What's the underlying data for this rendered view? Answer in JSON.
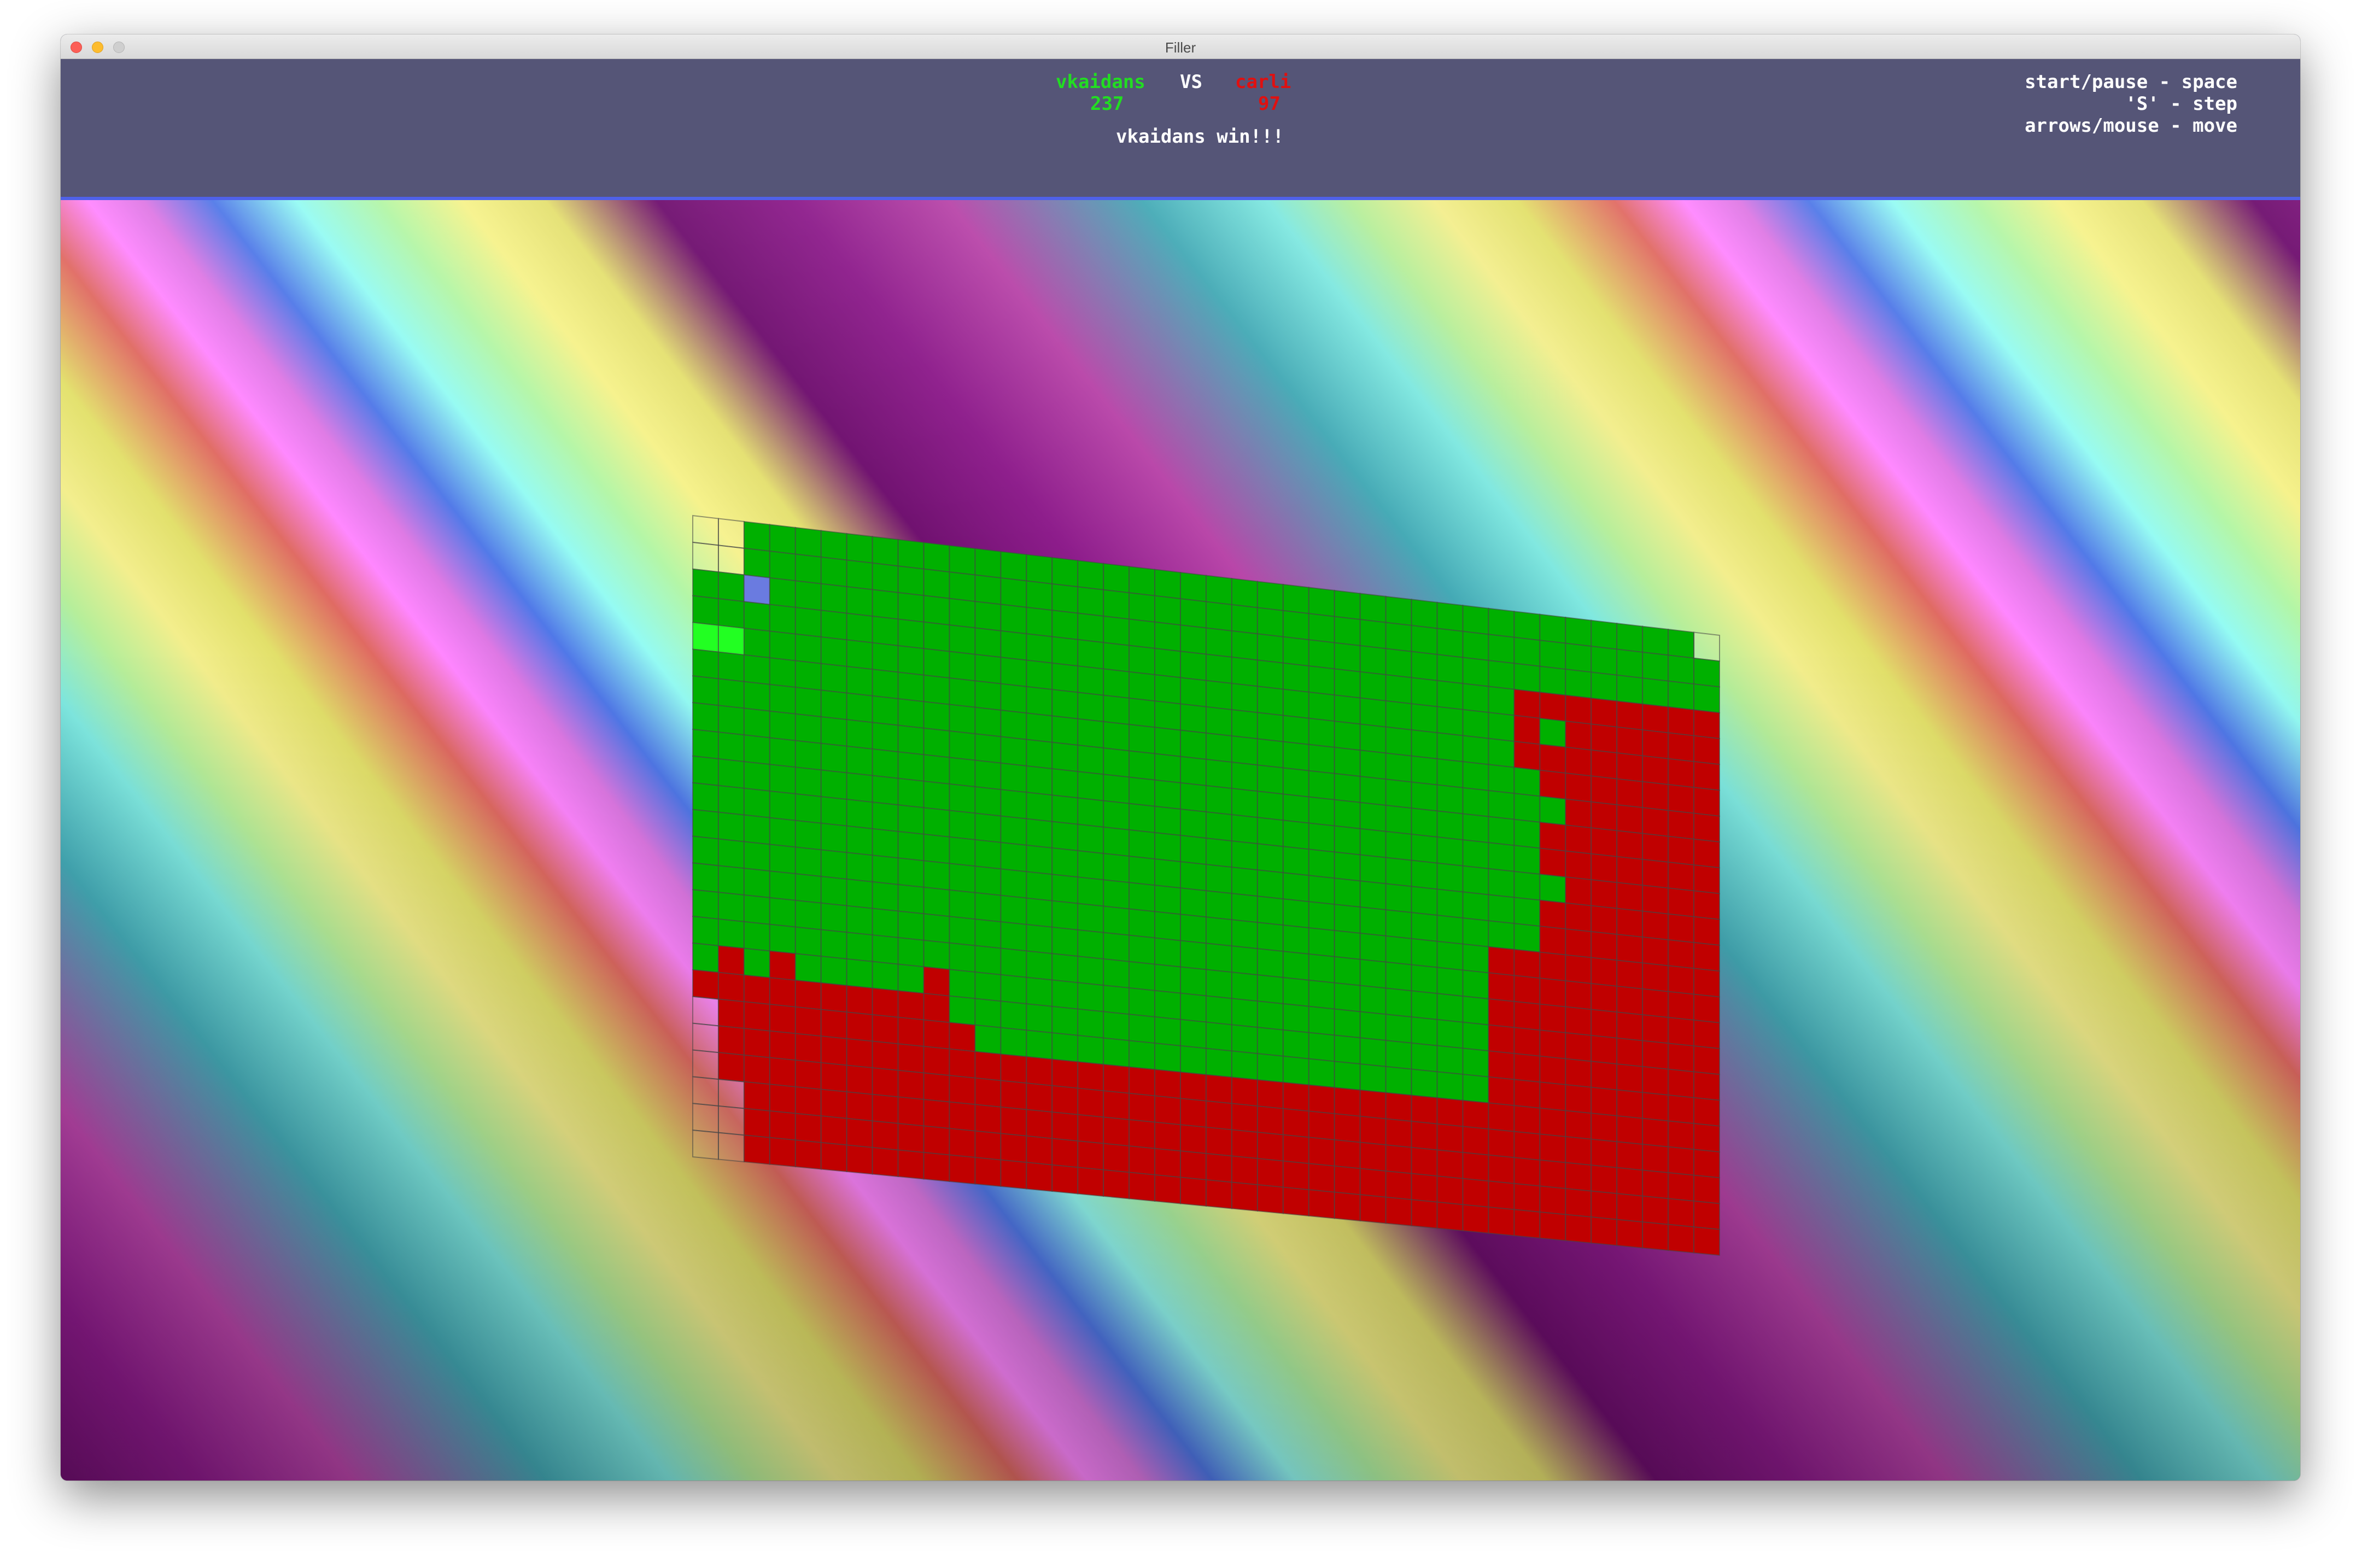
{
  "window": {
    "title": "Filler"
  },
  "players": {
    "p1": {
      "name": "vkaidans",
      "score": "237",
      "color": "#22dd22"
    },
    "vs": "VS",
    "p2": {
      "name": "carli",
      "score": "97",
      "color": "#e01010"
    }
  },
  "result": "vkaidans win!!!",
  "help": [
    "start/pause - space",
    "'S' - step",
    "arrows/mouse - move"
  ],
  "board": {
    "cols": 40,
    "rows": 24,
    "cells": [
      "EE.....................................E",
      "EE......................................",
      "..B.....................................",
      "................................RR......",
      "NN..............................R.......",
      "................................RR......",
      "........................................",
      "........................................",
      "........................................",
      "........................................",
      "........................................",
      "........................................",
      "........................................",
      "........................................",
      "........................................",
      "........................................",
      ".R.R.....R..............................",
      "RRRRRRRRRR..............................",
      "ERRRRRRRRRR.............................",
      "ERRRRRRRRRRRRRRRRRRRRRRRRRRRRRRRRRRRRRRR",
      "ERRRRRRRRRRRRRRRRRRRRRRRRRRRRRRRRRRRRRRR",
      "EERRRRRRRRRRRRRRRRRRRRRRRRRRRRRRRRRRRRRR",
      "EERRRRRRRRRRRRRRRRRRRRRRRRRRRRRRRRRRRRRR",
      "EERRRRRRRRRRRRRRRRRRRRRRRRRRRRRRRRRRRRRR"
    ],
    "legend": {
      "player1": "#00b000",
      "player1_last": "#22ff22",
      "player2": "#c00000",
      "empty": "transparent",
      "marker": "#6a7be0"
    }
  }
}
